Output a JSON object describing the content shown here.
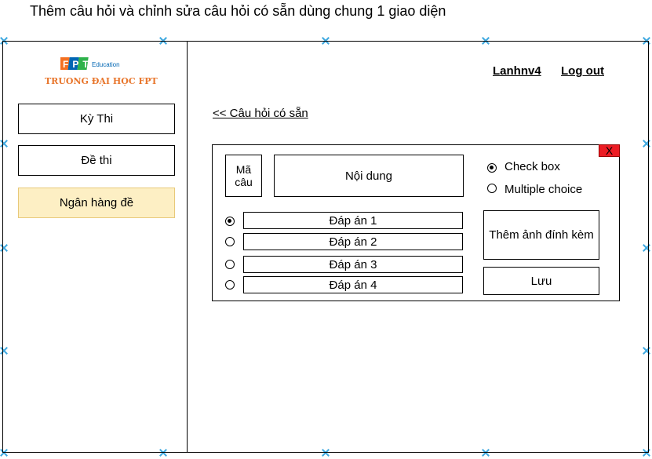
{
  "caption": "Thêm câu hỏi và chỉnh sửa câu hỏi có sẵn dùng chung 1 giao diện",
  "logo": {
    "brand": "FPT",
    "sub": "Education",
    "university": "TRUONG ĐẠI HỌC FPT",
    "colors": {
      "f": "#f37021",
      "p": "#0066b3",
      "t": "#2eb24b",
      "text": "#e8762c"
    }
  },
  "sidebar": {
    "items": [
      {
        "label": "Kỳ Thi",
        "active": false
      },
      {
        "label": "Đề thi",
        "active": false
      },
      {
        "label": "Ngân hàng đề",
        "active": true
      }
    ]
  },
  "header": {
    "user": "Lanhnv4",
    "logout": "Log out"
  },
  "back_link": "<< Câu hỏi có sẵn",
  "form": {
    "close_label": "X",
    "id_label": "Mã câu",
    "content_label": "Nội dung",
    "question_types": [
      {
        "label": "Check box",
        "selected": true
      },
      {
        "label": "Multiple choice",
        "selected": false
      }
    ],
    "answers": [
      {
        "label": "Đáp án 1",
        "selected": true
      },
      {
        "label": "Đáp án 2",
        "selected": false
      },
      {
        "label": "Đáp án 3",
        "selected": false
      },
      {
        "label": "Đáp án 4",
        "selected": false
      }
    ],
    "attach_label": "Thêm ảnh đính kèm",
    "save_label": "Lưu"
  },
  "colors": {
    "accent_active": "#fdefc4",
    "close_red": "#ec1c24",
    "selection_markers": "#3fa9e0"
  }
}
